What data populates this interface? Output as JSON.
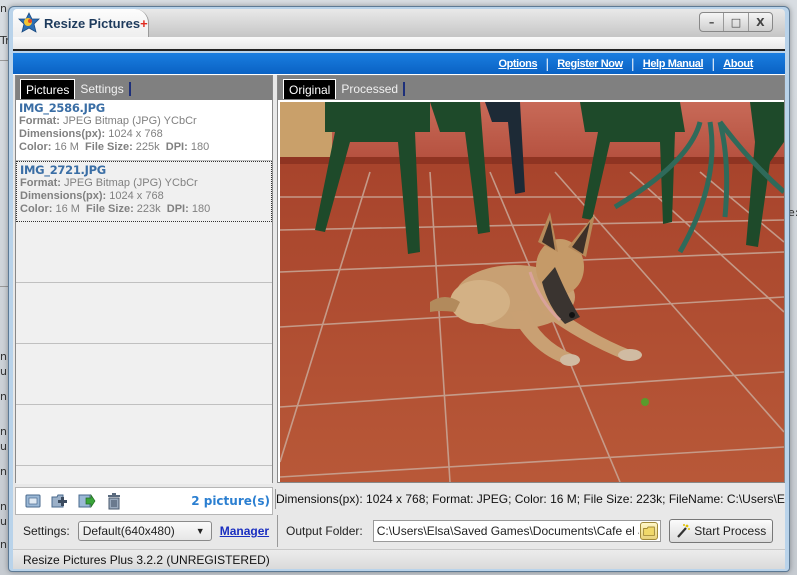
{
  "window": {
    "title": "Resize Pictures",
    "title_suffix": "+",
    "controls": {
      "minimize": "–",
      "maximize": "□",
      "close": "X"
    }
  },
  "linkbar": {
    "links": [
      "Options",
      "Register Now",
      "Help Manual",
      "About"
    ],
    "separator": "|"
  },
  "left_panel": {
    "tabs": [
      {
        "label": "Pictures",
        "active": true
      },
      {
        "label": "Settings",
        "active": false
      }
    ],
    "pictures": [
      {
        "name": "IMG_2586.JPG",
        "format_label": "Format:",
        "format": "JPEG Bitmap (JPG) YCbCr",
        "dimensions_label": "Dimensions(px):",
        "dimensions": "1024 x 768",
        "color_label": "Color:",
        "color": "16 M",
        "file_size_label": "File Size:",
        "file_size": "225k",
        "dpi_label": "DPI:",
        "dpi": "180",
        "selected": false
      },
      {
        "name": "IMG_2721.JPG",
        "format_label": "Format:",
        "format": "JPEG Bitmap (JPG) YCbCr",
        "dimensions_label": "Dimensions(px):",
        "dimensions": "1024 x 768",
        "color_label": "Color:",
        "color": "16 M",
        "file_size_label": "File Size:",
        "file_size": "223k",
        "dpi_label": "DPI:",
        "dpi": "180",
        "selected": true
      }
    ],
    "toolbar_icons": [
      "add-images-icon",
      "add-folder-icon",
      "export-icon",
      "delete-icon"
    ],
    "picture_count": "2 picture(s)"
  },
  "right_panel": {
    "tabs": [
      {
        "label": "Original",
        "active": true
      },
      {
        "label": "Processed",
        "active": false
      }
    ],
    "preview_alt": "Puppy lying on terracotta tile floor near green chairs",
    "info_line": "Dimensions(px):  1024 x 768;  Format: JPEG;  Color: 16 M;  File Size: 223k;  FileName: C:\\Users\\Elsa\\Saved"
  },
  "settings": {
    "label": "Settings:",
    "selected_value": "Default(640x480)",
    "manager_link": "Manager"
  },
  "output": {
    "label": "Output Folder:",
    "path": "C:\\Users\\Elsa\\Saved Games\\Documents\\Cafe el Jardin",
    "start_button": "Start Process"
  },
  "statusbar": {
    "text": "Resize Pictures Plus 3.2.2 (UNREGISTERED)"
  },
  "background": {
    "left_fragments": [
      "n",
      "Tr",
      "n",
      "u",
      "n",
      "n",
      "u",
      "n",
      "n",
      "u",
      "n"
    ],
    "right_fragment": "e:"
  }
}
